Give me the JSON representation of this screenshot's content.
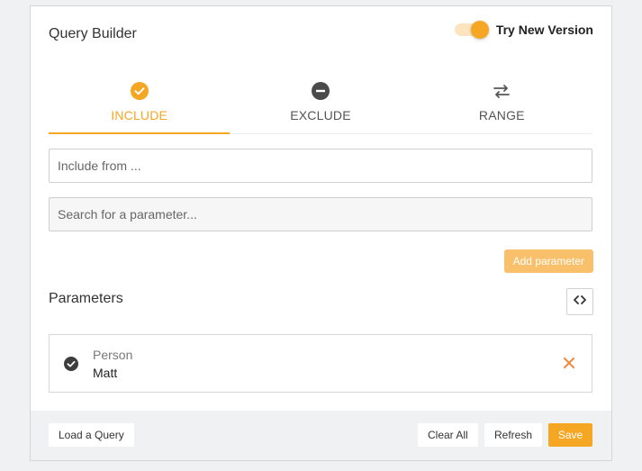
{
  "header": {
    "title": "Query Builder",
    "toggle_label": "Try New Version",
    "toggle_on": true
  },
  "tabs": [
    {
      "label": "INCLUDE",
      "icon": "check-circle-icon",
      "active": true
    },
    {
      "label": "EXCLUDE",
      "icon": "minus-circle-icon",
      "active": false
    },
    {
      "label": "RANGE",
      "icon": "swap-arrows-icon",
      "active": false
    }
  ],
  "inputs": {
    "include_placeholder": "Include from ...",
    "include_value": "",
    "search_placeholder": "Search for a parameter...",
    "search_value": ""
  },
  "add_parameter_label": "Add parameter",
  "parameters": {
    "heading": "Parameters",
    "code_icon": "code-brackets-icon",
    "items": [
      {
        "name": "Person",
        "value": "Matt"
      }
    ]
  },
  "footer": {
    "load_label": "Load a Query",
    "clear_label": "Clear All",
    "refresh_label": "Refresh",
    "save_label": "Save"
  },
  "colors": {
    "accent": "#f5a623",
    "accent_light": "#f8c06a",
    "remove": "#f0883e"
  }
}
